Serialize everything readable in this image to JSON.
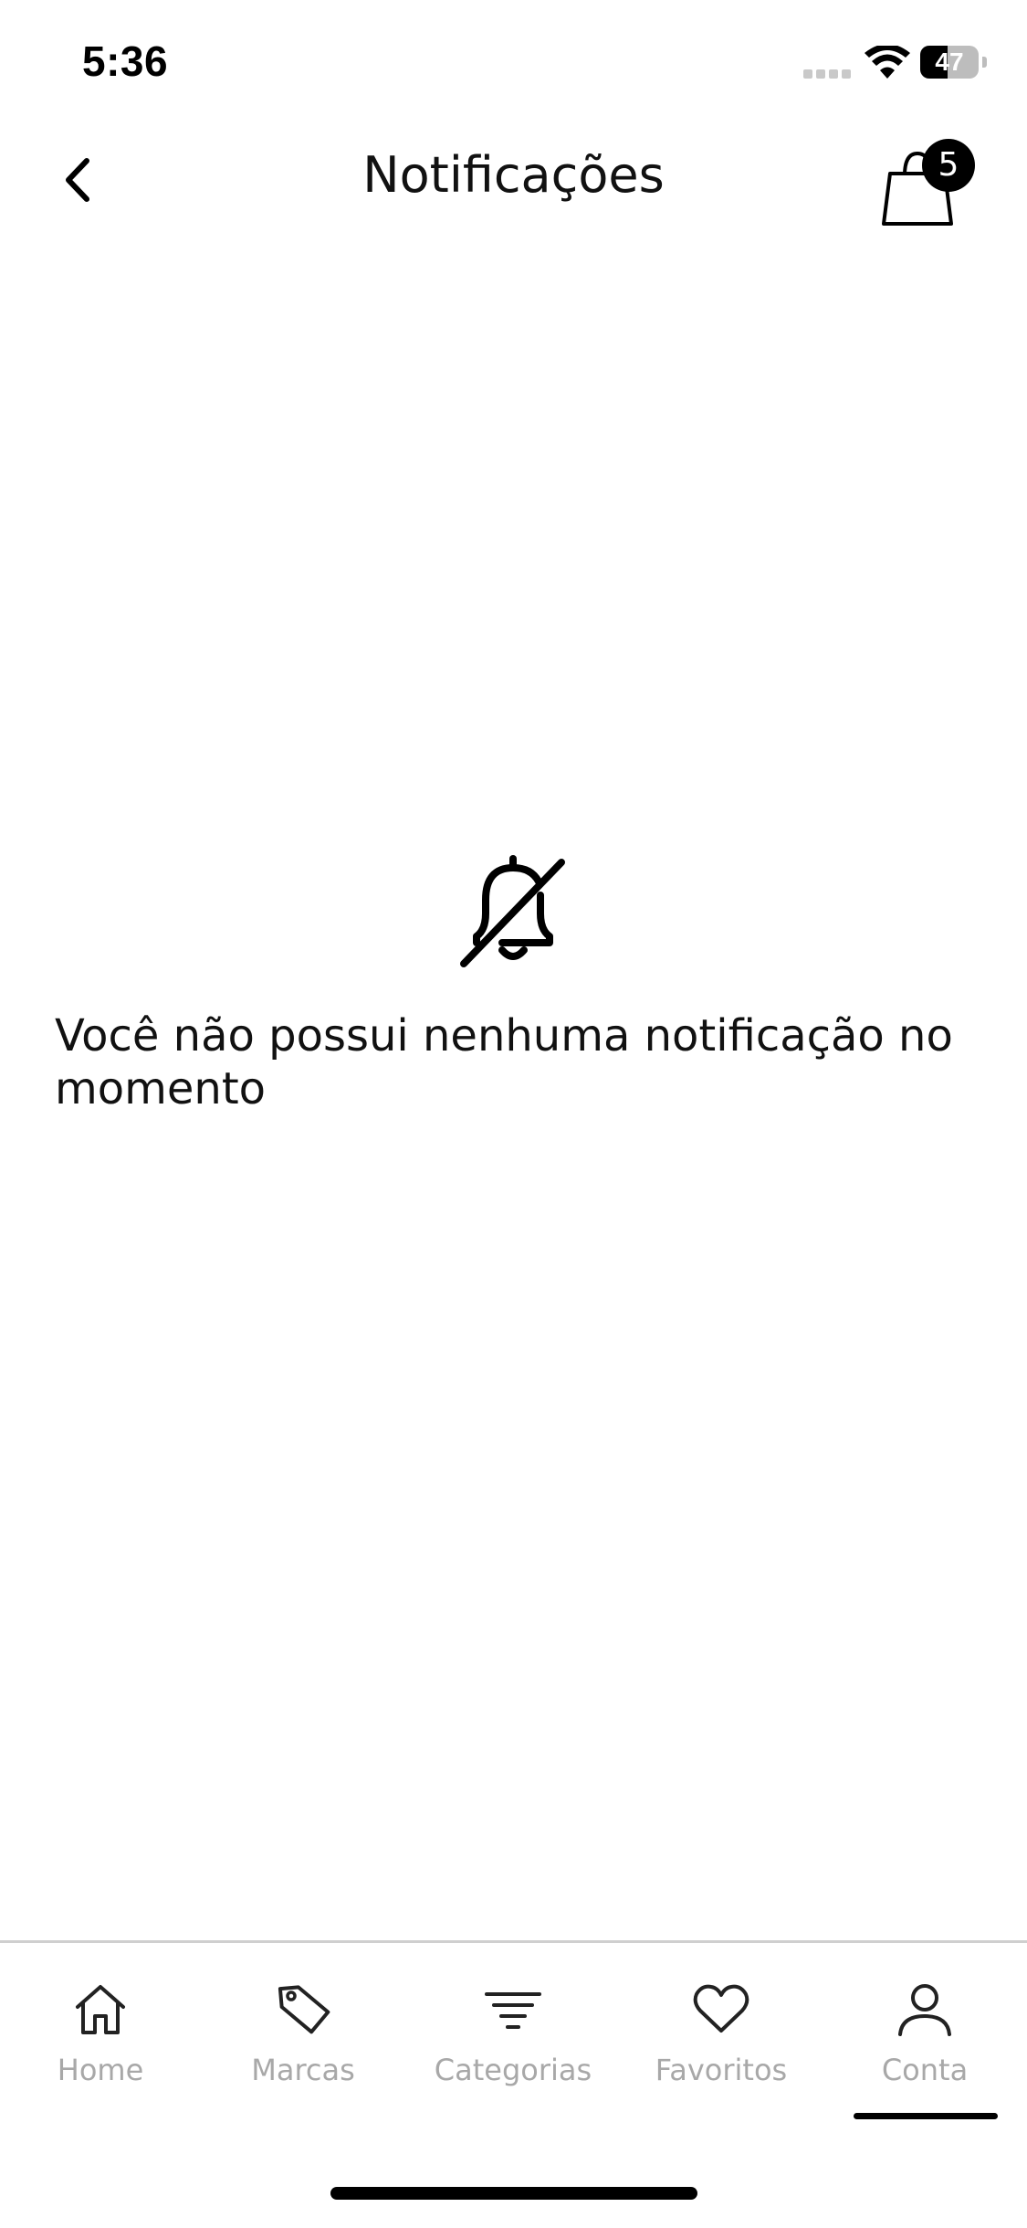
{
  "status_bar": {
    "time": "5:36",
    "battery_level": "47"
  },
  "header": {
    "title": "Notificações",
    "cart_count": "5",
    "back_icon": "chevron-left-icon",
    "cart_icon": "shopping-bag-icon"
  },
  "empty_state": {
    "icon": "bell-off-icon",
    "message": "Você não possui nenhuma notificação no momento"
  },
  "bottom_nav": {
    "items": [
      {
        "label": "Home",
        "icon": "home-icon"
      },
      {
        "label": "Marcas",
        "icon": "tag-icon"
      },
      {
        "label": "Categorias",
        "icon": "filter-icon"
      },
      {
        "label": "Favoritos",
        "icon": "heart-icon"
      },
      {
        "label": "Conta",
        "icon": "user-icon"
      }
    ],
    "active_index": 4
  },
  "colors": {
    "text": "#111111",
    "nav_inactive": "#a8a8a8",
    "badge_bg": "#000000",
    "divider": "#cfcfcf"
  }
}
